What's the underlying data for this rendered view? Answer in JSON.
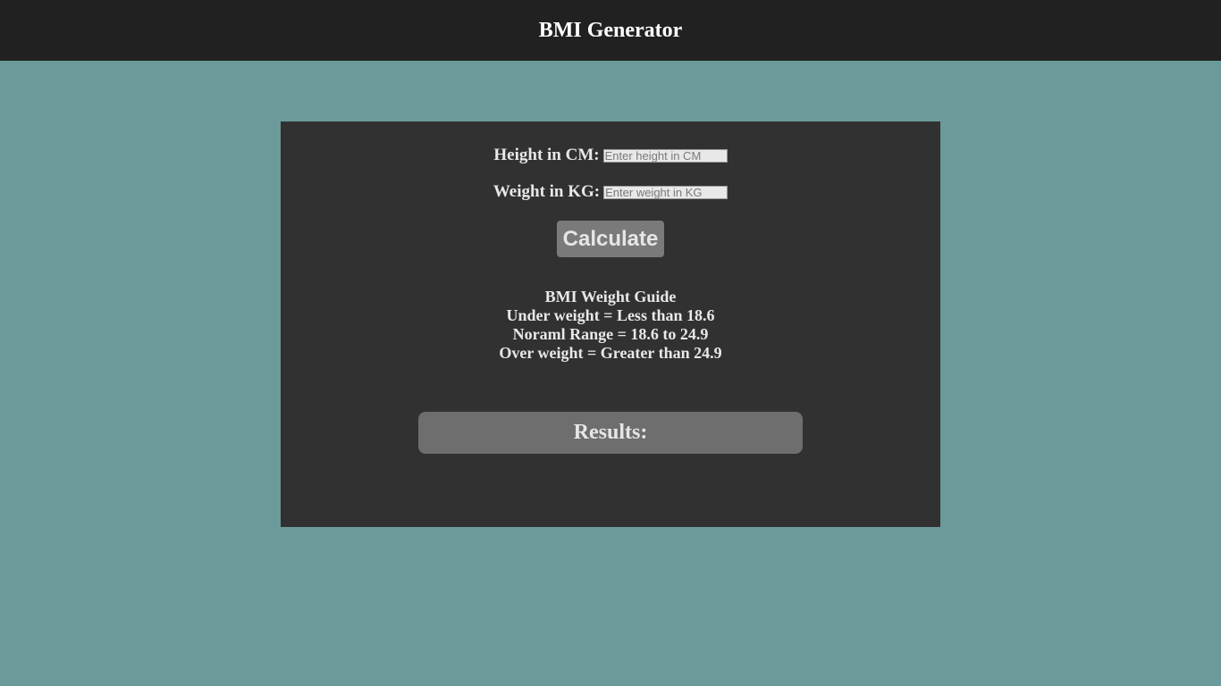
{
  "header": {
    "title": "BMI Generator"
  },
  "form": {
    "height_label": "Height in CM:",
    "height_placeholder": "Enter height in CM",
    "height_value": "",
    "weight_label": "Weight in KG:",
    "weight_placeholder": "Enter weight in KG",
    "weight_value": "",
    "calculate_label": "Calculate"
  },
  "guide": {
    "title": "BMI Weight Guide",
    "lines": [
      "Under weight = Less than 18.6",
      "Noraml Range = 18.6 to 24.9",
      "Over weight = Greater than 24.9"
    ]
  },
  "results": {
    "label": "Results:"
  },
  "colors": {
    "page_background": "#6c9a9a",
    "header_background": "#212121",
    "panel_background": "#323132",
    "button_background": "#7a7a7a",
    "results_background": "#6e6e6e"
  }
}
